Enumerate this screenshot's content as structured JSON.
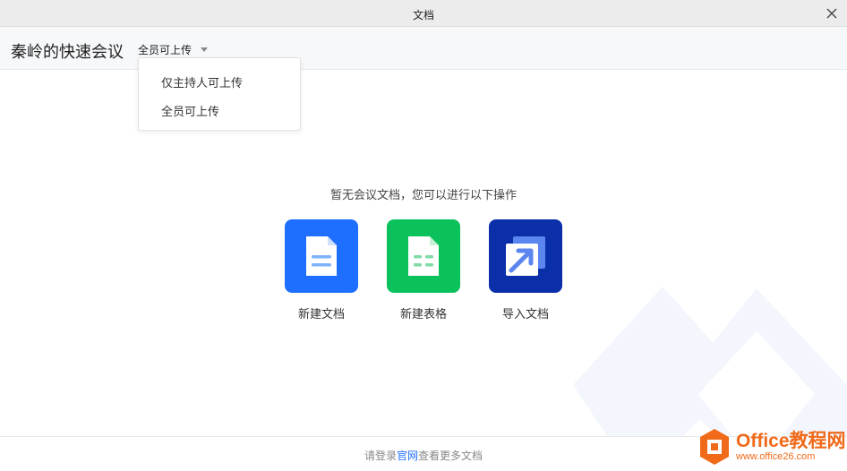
{
  "window": {
    "title": "文档"
  },
  "header": {
    "meeting_title": "秦岭的快速会议",
    "upload_permission": "全员可上传"
  },
  "dropdown": {
    "options": [
      "仅主持人可上传",
      "全员可上传"
    ]
  },
  "main": {
    "empty_message": "暂无会议文档，您可以进行以下操作",
    "actions": [
      {
        "label": "新建文档",
        "icon": "document-icon",
        "color": "#1e6fff"
      },
      {
        "label": "新建表格",
        "icon": "spreadsheet-icon",
        "color": "#0bc15c"
      },
      {
        "label": "导入文档",
        "icon": "import-icon",
        "color": "#0a2fa8"
      }
    ]
  },
  "footer": {
    "prefix": "请登录",
    "link": "官网",
    "suffix": "查看更多文档"
  },
  "watermark": {
    "brand": "Office教程网",
    "url": "www.office26.com"
  }
}
